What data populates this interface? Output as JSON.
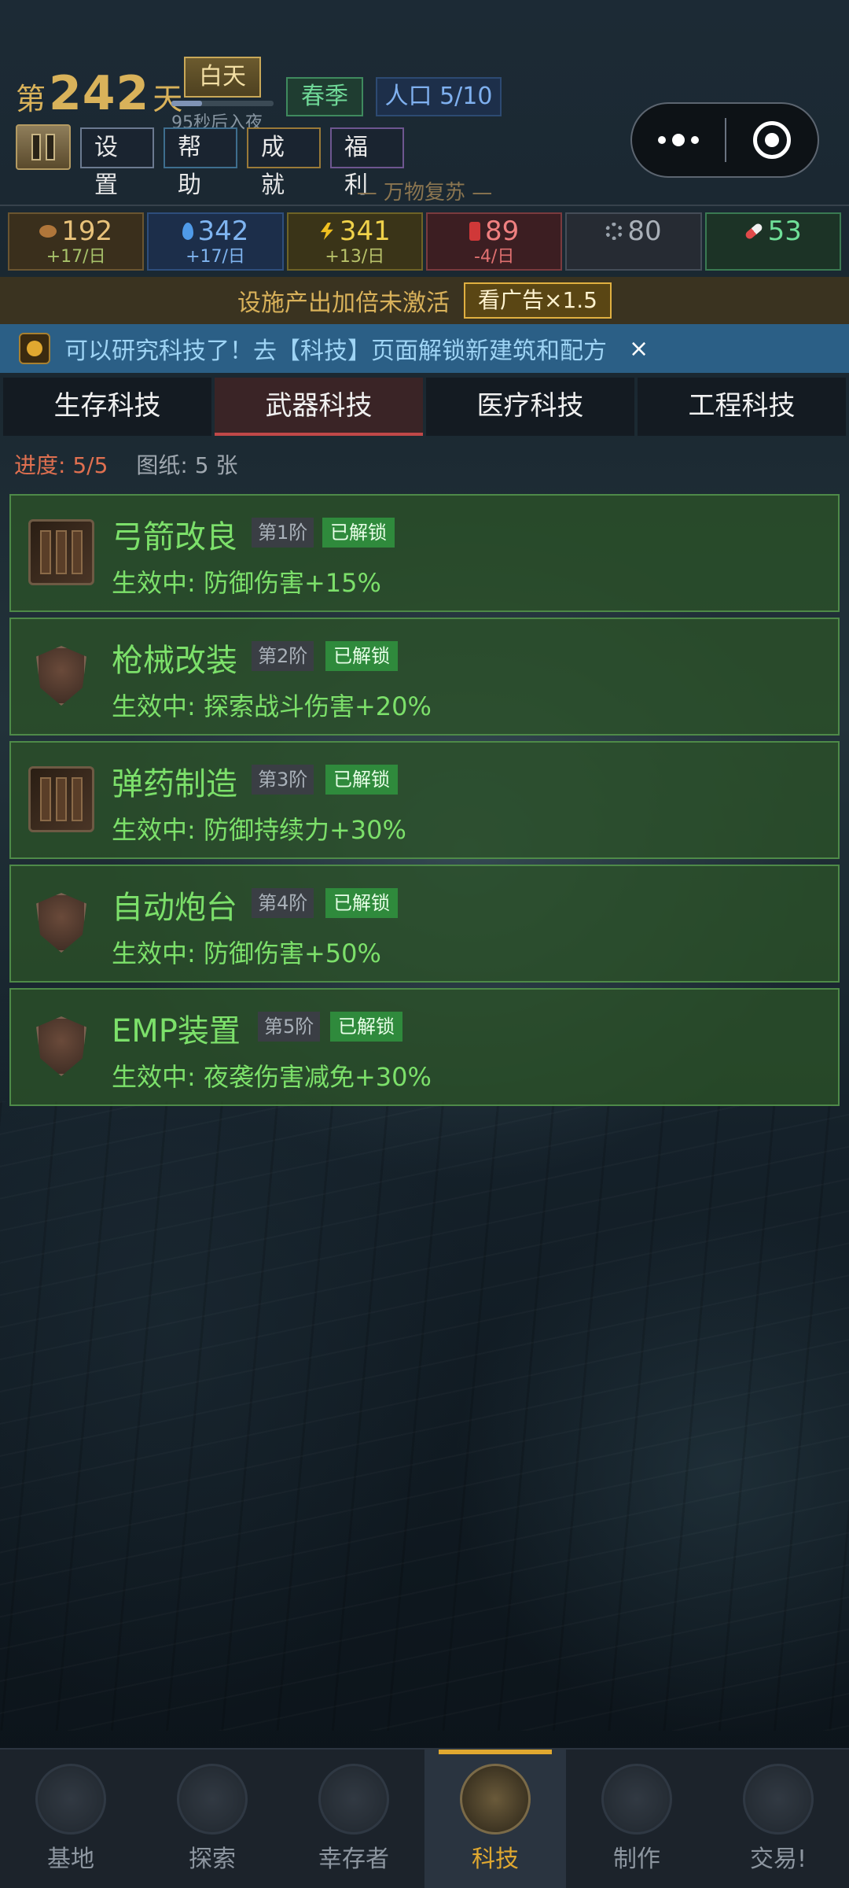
{
  "header": {
    "day_prefix": "第",
    "day_number": "242",
    "day_suffix": "天",
    "daytime": "白天",
    "night_progress": 0.3,
    "night_countdown": "95秒后入夜",
    "season": "春季",
    "population": "人口 5/10",
    "buttons": {
      "settings": "设置",
      "help": "帮助",
      "achievements": "成就",
      "welfare": "福利"
    },
    "motto": "— 万物复苏 —"
  },
  "resources": [
    {
      "icon": "food-icon",
      "value": "192",
      "rate": "+17/日"
    },
    {
      "icon": "water-drop-icon",
      "value": "342",
      "rate": "+17/日"
    },
    {
      "icon": "lightning-icon",
      "value": "341",
      "rate": "+13/日"
    },
    {
      "icon": "fuel-canister-icon",
      "value": "89",
      "rate": "-4/日"
    },
    {
      "icon": "gear-icon",
      "value": "80",
      "rate": ""
    },
    {
      "icon": "pill-icon",
      "value": "53",
      "rate": ""
    }
  ],
  "boost_banner": {
    "text": "设施产出加倍未激活",
    "button": "看广告×1.5"
  },
  "notice": {
    "text": "可以研究科技了！去【科技】页面解锁新建筑和配方",
    "close": "×"
  },
  "tabs": [
    "生存科技",
    "武器科技",
    "医疗科技",
    "工程科技"
  ],
  "active_tab": 1,
  "progress": {
    "progress_text": "进度: 5/5",
    "blueprints_text": "图纸: 5 张"
  },
  "techs": [
    {
      "name": "弓箭改良",
      "tier": "第1阶",
      "status": "已解锁",
      "effect": "生效中: 防御伤害+15%",
      "icon": "weapon-rack-icon"
    },
    {
      "name": "枪械改装",
      "tier": "第2阶",
      "status": "已解锁",
      "effect": "生效中: 探索战斗伤害+20%",
      "icon": "shield-icon"
    },
    {
      "name": "弹药制造",
      "tier": "第3阶",
      "status": "已解锁",
      "effect": "生效中: 防御持续力+30%",
      "icon": "weapon-rack-icon"
    },
    {
      "name": "自动炮台",
      "tier": "第4阶",
      "status": "已解锁",
      "effect": "生效中: 防御伤害+50%",
      "icon": "shield-icon"
    },
    {
      "name": "EMP装置",
      "tier": "第5阶",
      "status": "已解锁",
      "effect": "生效中: 夜袭伤害减免+30%",
      "icon": "shield-icon"
    }
  ],
  "bottom_nav": [
    {
      "label": "基地",
      "icon": "base-icon"
    },
    {
      "label": "探索",
      "icon": "compass-icon"
    },
    {
      "label": "幸存者",
      "icon": "survivors-icon"
    },
    {
      "label": "科技",
      "icon": "tech-gear-icon"
    },
    {
      "label": "制作",
      "icon": "crafting-icon"
    },
    {
      "label": "交易!",
      "icon": "trade-icon"
    }
  ],
  "active_nav": 3
}
